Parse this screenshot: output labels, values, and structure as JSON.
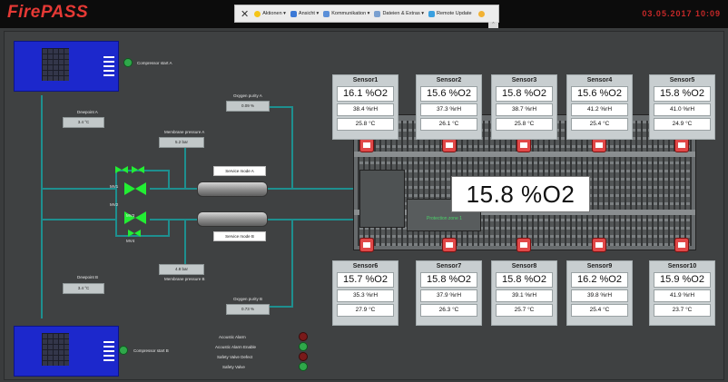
{
  "header": {
    "logo": "FirePASS",
    "datetime": "03.05.2017  10:09"
  },
  "menu": {
    "close": "✕",
    "items": [
      {
        "label": "Aktionen ▾",
        "icon": "lightbulb-icon",
        "color": "#f5c518"
      },
      {
        "label": "Ansicht ▾",
        "icon": "view-icon",
        "color": "#3b79d6"
      },
      {
        "label": "Kommunikation ▾",
        "icon": "communication-icon",
        "color": "#5a8fd8"
      },
      {
        "label": "Dateien & Extras ▾",
        "icon": "files-icon",
        "color": "#7aa0d0"
      },
      {
        "label": "Remote Update",
        "icon": "update-icon",
        "color": "#3aa0e0"
      }
    ],
    "sub": "⌃"
  },
  "system": {
    "compressor_a_label": "Compressor start A",
    "compressor_b_label": "Compressor start B",
    "dewpoint_a_label": "Dewpoint A",
    "dewpoint_a_value": "3.4 °C",
    "dewpoint_b_label": "Dewpoint B",
    "dewpoint_b_value": "3.4 °C",
    "pressure_a_label": "Membrane pressure A",
    "pressure_a_value": "5.2 bar",
    "pressure_b_label": "Membrane pressure B",
    "pressure_b_value": "4.8 bar",
    "purity_a_label": "Oxygen purity A",
    "purity_a_value": "0.09 %",
    "purity_b_label": "Oxygen purity B",
    "purity_b_value": "0.73 %",
    "service_a": "Service mode A",
    "service_b": "Service mode B",
    "valve_a1": "MV1",
    "valve_a2": "MV2",
    "valve_b1": "MV3",
    "valve_b2": "MV4"
  },
  "alarms": [
    {
      "label": "Acoustic Alarm",
      "state": "red"
    },
    {
      "label": "Acoustic Alarm Enable",
      "state": "green"
    },
    {
      "label": "Safety Valve Defect",
      "state": "red"
    },
    {
      "label": "Safety Valve",
      "state": "green"
    }
  ],
  "room": {
    "o2_value": "15.8 %O2",
    "pipe_note": "Protection zone 1"
  },
  "sensors_top": [
    {
      "name": "Sensor1",
      "o2": "16.1 %O2",
      "rh": "38.4 %rH",
      "temp": "25.8 °C"
    },
    {
      "name": "Sensor2",
      "o2": "15.6 %O2",
      "rh": "37.3 %rH",
      "temp": "26.1 °C"
    },
    {
      "name": "Sensor3",
      "o2": "15.8 %O2",
      "rh": "38.7 %rH",
      "temp": "25.8 °C"
    },
    {
      "name": "Sensor4",
      "o2": "15.6 %O2",
      "rh": "41.2 %rH",
      "temp": "25.4 °C"
    },
    {
      "name": "Sensor5",
      "o2": "15.8 %O2",
      "rh": "41.0 %rH",
      "temp": "24.9 °C"
    }
  ],
  "sensors_bottom": [
    {
      "name": "Sensor6",
      "o2": "15.7 %O2",
      "rh": "35.3 %rH",
      "temp": "27.9 °C"
    },
    {
      "name": "Sensor7",
      "o2": "15.8 %O2",
      "rh": "37.9 %rH",
      "temp": "26.3 °C"
    },
    {
      "name": "Sensor8",
      "o2": "15.8 %O2",
      "rh": "39.1 %rH",
      "temp": "25.7 °C"
    },
    {
      "name": "Sensor9",
      "o2": "16.2 %O2",
      "rh": "39.8 %rH",
      "temp": "25.4 °C"
    },
    {
      "name": "Sensor10",
      "o2": "15.9 %O2",
      "rh": "41.9 %rH",
      "temp": "23.7 °C"
    }
  ],
  "colors": {
    "accent_red": "#e53935",
    "pipe": "#1e8f8f",
    "tank": "#1c28cc",
    "valve": "#22ee33"
  }
}
